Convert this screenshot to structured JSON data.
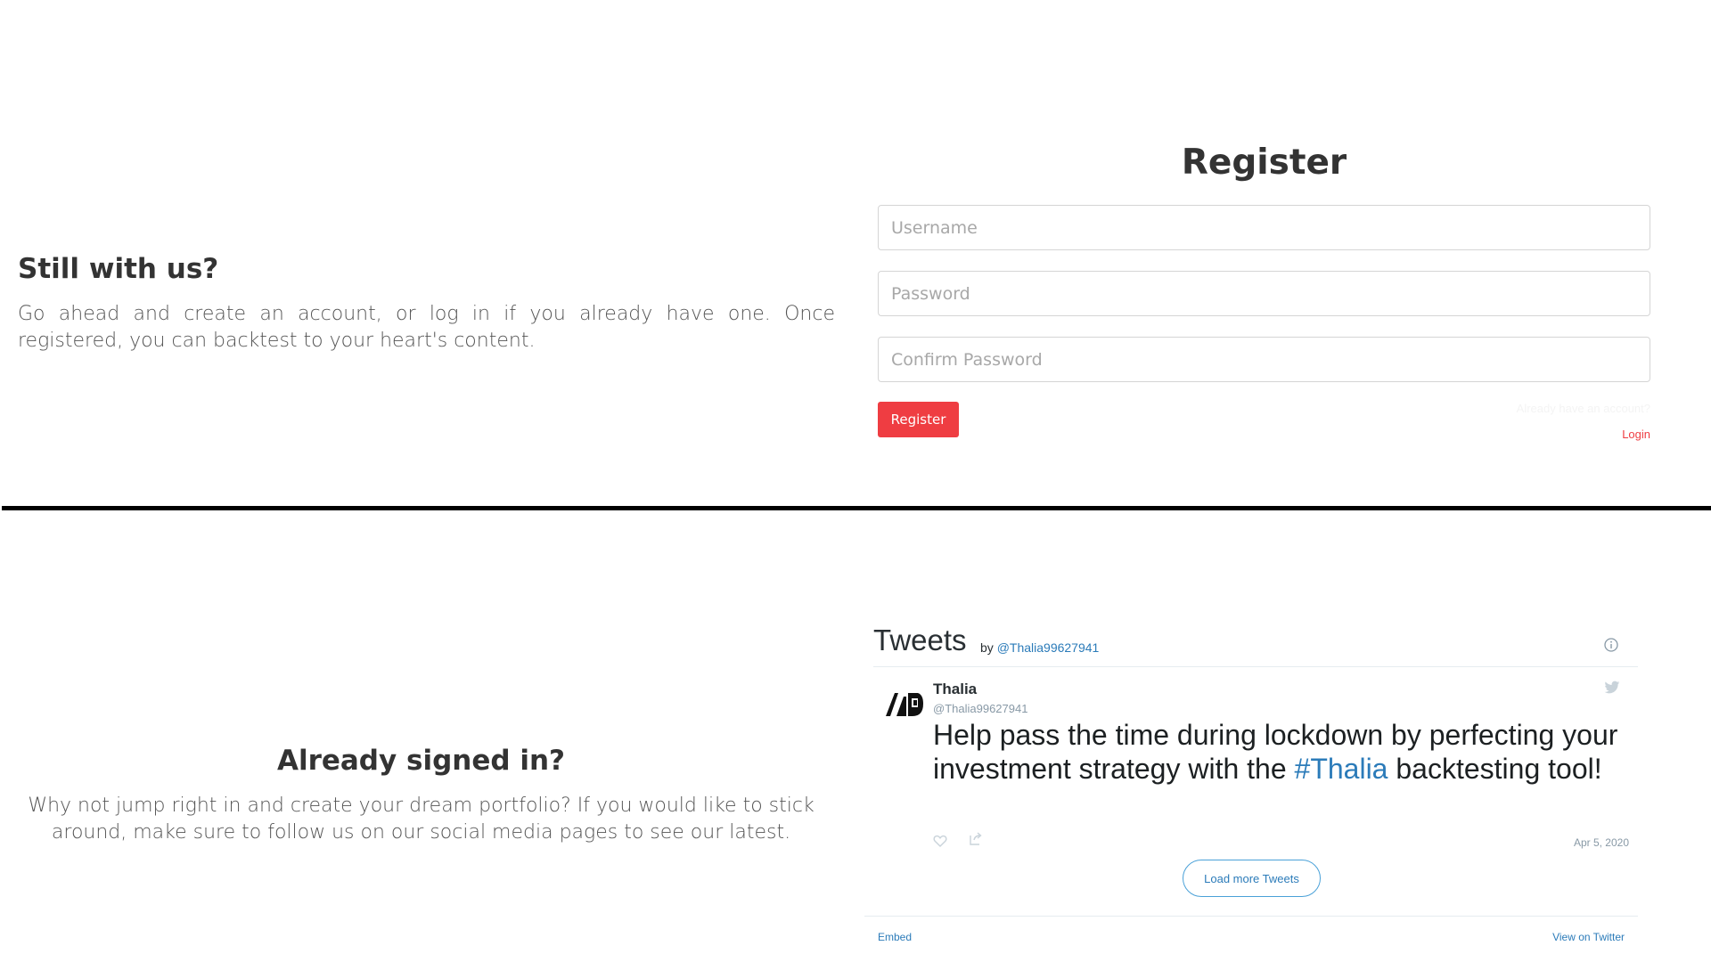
{
  "intro": {
    "title": "Still with us?",
    "text": "Go ahead and create an account, or log in if you already have one. Once registered, you can backtest to your heart's content."
  },
  "register": {
    "heading": "Register",
    "username_placeholder": "Username",
    "password_placeholder": "Password",
    "confirm_placeholder": "Confirm Password",
    "button_label": "Register",
    "already_text": "Already have an account?",
    "login_label": "Login"
  },
  "signed_in": {
    "title": "Already signed in?",
    "text": "Why not jump right in and create your dream portfolio? If you would like to stick around, make sure to follow us on our social media pages to see our latest."
  },
  "twitter": {
    "title": "Tweets",
    "by": "by",
    "by_handle": "@Thalia99627941",
    "tweet": {
      "author_name": "Thalia",
      "author_handle": "@Thalia99627941",
      "text_before": "Help pass the time during lockdown by perfecting your investment strategy with the ",
      "hashtag": "#Thalia",
      "text_after": " backtesting tool!",
      "date": "Apr 5, 2020"
    },
    "load_more": "Load more Tweets",
    "embed": "Embed",
    "view_on_twitter": "View on Twitter"
  },
  "colors": {
    "accent": "#ef3d42",
    "twitter_blue": "#2b7bb9",
    "divider": "#000000"
  }
}
